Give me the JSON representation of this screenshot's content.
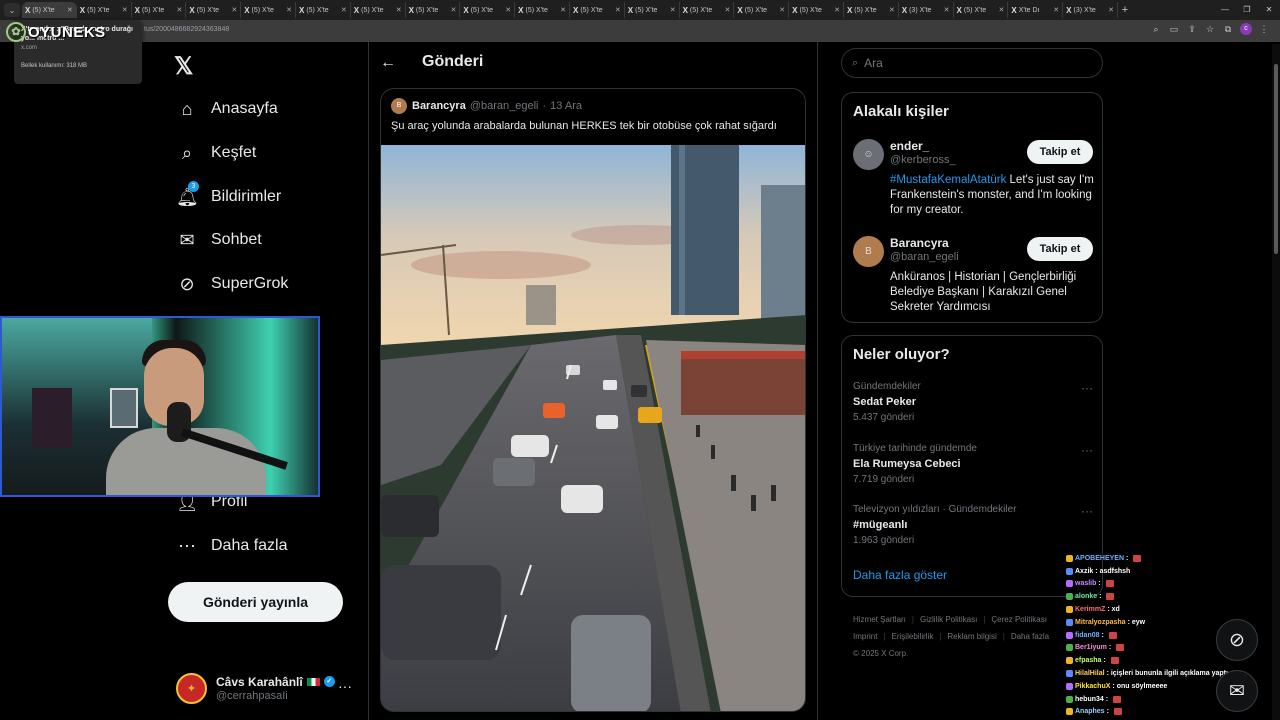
{
  "browser": {
    "active_tab": "(5) X'te",
    "tabs": [
      "(5) X'te",
      "(5) X'te",
      "(5) X'te",
      "(5) X'te",
      "(5) X'te",
      "(5) X'te",
      "(5) X'te",
      "(5) X'te",
      "(5) X'te",
      "(5) X'te",
      "(5) X'te",
      "(5) X'te",
      "(5) X'te",
      "(5) X'te",
      "(5) X'te",
      "(5) X'te",
      "(3) X'te",
      "(5) X'te",
      "X'te Dı",
      "(3) X'te"
    ],
    "url": "tus/2000486682924363848",
    "tab_popup": {
      "title": "X'te ender : \"Burada metro durağı",
      "title2": "yo...                               metro ...",
      "domain": "x.com",
      "memory": "Bellek kullanımı: 318 MB"
    },
    "profile_initial": "c"
  },
  "stream_logo": {
    "text": "OYUNEKS"
  },
  "nav": {
    "logo": "𝕏",
    "items": [
      {
        "label": "Anasayfa",
        "icon": "home-icon",
        "glyph": "⌂"
      },
      {
        "label": "Keşfet",
        "icon": "search-icon",
        "glyph": "⌕"
      },
      {
        "label": "Bildirimler",
        "icon": "bell-icon",
        "glyph": "🔔︎",
        "badge": "3"
      },
      {
        "label": "Sohbet",
        "icon": "mail-icon",
        "glyph": "✉"
      },
      {
        "label": "SuperGrok",
        "icon": "grok-icon",
        "glyph": "⊘"
      },
      {
        "label": "Profil",
        "icon": "person-icon",
        "glyph": "👤︎"
      },
      {
        "label": "Daha fazla",
        "icon": "more-circle-icon",
        "glyph": "⋯"
      }
    ],
    "post_button": "Gönderi yayınla",
    "account": {
      "name": "Câvs Karahânlî",
      "handle": "@cerrahpasaIi",
      "more": "···"
    }
  },
  "main": {
    "header": {
      "back": "←",
      "title": "Gönderi"
    },
    "tweet": {
      "author_name": "Barancyra",
      "author_handle": "@baran_egeli",
      "separator": "·",
      "date": "13 Ara",
      "text": "Şu araç yolunda arabalarda bulunan HERKES tek bir otobüse çok rahat sığardı"
    }
  },
  "sidebar": {
    "search_placeholder": "Ara",
    "relevant": {
      "title": "Alakalı kişiler",
      "people": [
        {
          "name": "ender_",
          "handle": "@kerbeross_",
          "bio_tag": "#MustafaKemalAtatürk",
          "bio": " Let's just say I'm Frankenstein's monster, and I'm looking for my creator.",
          "follow": "Takip et"
        },
        {
          "name": "Barancyra",
          "handle": "@baran_egeli",
          "bio_tag": "",
          "bio": "Anküranos | Historian | Gençlerbirliği Belediye Başkanı | Karakızıl Genel Sekreter Yardımcısı",
          "follow": "Takip et"
        }
      ]
    },
    "trends": {
      "title": "Neler oluyor?",
      "items": [
        {
          "context": "Gündemdekiler",
          "name": "Sedat Peker",
          "count": "5.437 gönderi"
        },
        {
          "context": "Türkiye tarihinde gündemde",
          "name": "Ela Rumeysa Cebeci",
          "count": "7.719 gönderi"
        },
        {
          "context": "Televizyon yıldızları · Gündemdekiler",
          "name": "#mügeanlı",
          "count": "1.963 gönderi"
        }
      ],
      "show_more": "Daha fazla göster",
      "more": "···"
    },
    "footer": {
      "links": [
        "Hizmet Şartları",
        "Gizlilik Politikası",
        "Çerez Politikası",
        "Imprint",
        "Erişilebilirlik",
        "Reklam bilgisi",
        "Daha fazla"
      ],
      "copyright": "© 2025 X Corp."
    }
  },
  "chat": {
    "lines": [
      {
        "user": "APOBEHEYEN",
        "msg": "",
        "color": "#6fb0ff"
      },
      {
        "user": "Axzik",
        "msg": "asdfshsh",
        "color": "#ffffff"
      },
      {
        "user": "waslib",
        "msg": "",
        "color": "#c58cff"
      },
      {
        "user": "alonke",
        "msg": "",
        "color": "#6fe3a0"
      },
      {
        "user": "KerimmZ",
        "msg": "xd",
        "color": "#ff7070"
      },
      {
        "user": "Mitralyozpasha",
        "msg": "eyw",
        "color": "#ffb84d"
      },
      {
        "user": "fidan08",
        "msg": "",
        "color": "#6fb0ff"
      },
      {
        "user": "Ber1iyum",
        "msg": "",
        "color": "#ff8ad8"
      },
      {
        "user": "efpasha",
        "msg": "",
        "color": "#c0ff70"
      },
      {
        "user": "HilalHilal",
        "msg": "içişleri bununla ilgili açıklama yaptı",
        "color": "#ffd166"
      },
      {
        "user": "PikkachuX",
        "msg": "onu söylmeeee",
        "color": "#ffe14d"
      },
      {
        "user": "hebun34",
        "msg": "",
        "color": "#ffffff"
      },
      {
        "user": "Anaphes",
        "msg": "",
        "color": "#9ad0ff"
      }
    ]
  }
}
